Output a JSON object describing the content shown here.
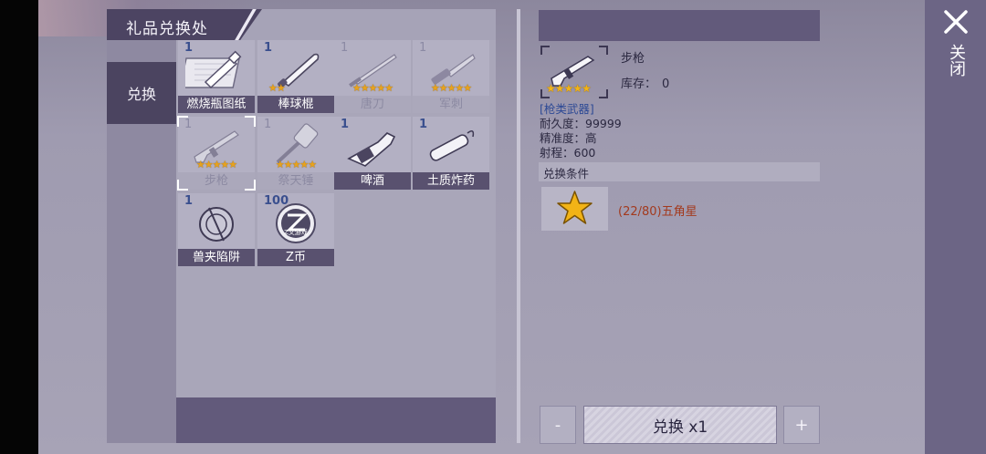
{
  "window": {
    "title": "礼品兑换处",
    "close_label": "关闭"
  },
  "sidebar": {
    "tab_label": "兑换"
  },
  "items": [
    {
      "name": "燃烧瓶图纸",
      "count": "1",
      "stars": 0,
      "available": true
    },
    {
      "name": "棒球棍",
      "count": "1",
      "stars": 2,
      "available": true
    },
    {
      "name": "唐刀",
      "count": "1",
      "stars": 5,
      "available": false
    },
    {
      "name": "军刺",
      "count": "1",
      "stars": 5,
      "available": false
    },
    {
      "name": "步枪",
      "count": "1",
      "stars": 5,
      "available": false,
      "selected": true
    },
    {
      "name": "祭天锤",
      "count": "1",
      "stars": 5,
      "available": false
    },
    {
      "name": "啤酒",
      "count": "1",
      "stars": 0,
      "available": true
    },
    {
      "name": "土质炸药",
      "count": "1",
      "stars": 0,
      "available": true
    },
    {
      "name": "兽夹陷阱",
      "count": "1",
      "stars": 0,
      "available": true
    },
    {
      "name": "Z币",
      "count": "100",
      "stars": 0,
      "available": true,
      "coin_text": "Z文游戏"
    }
  ],
  "detail": {
    "name": "步枪",
    "stock_label": "库存：",
    "stock_value": "0",
    "stars": 5,
    "category": "[枪类武器]",
    "durability": "耐久度：99999",
    "accuracy": "精准度：高",
    "range": "射程：600",
    "condition_title": "兑换条件",
    "condition_text": "(22/80)五角星"
  },
  "buttons": {
    "minus": "-",
    "plus": "+",
    "exchange": "兑换 x1"
  },
  "colors": {
    "panel_dark": "#4c4462",
    "accent_blue": "#3a4f8e",
    "condition_red": "#a33a1e",
    "star_gold": "#f2b316"
  }
}
